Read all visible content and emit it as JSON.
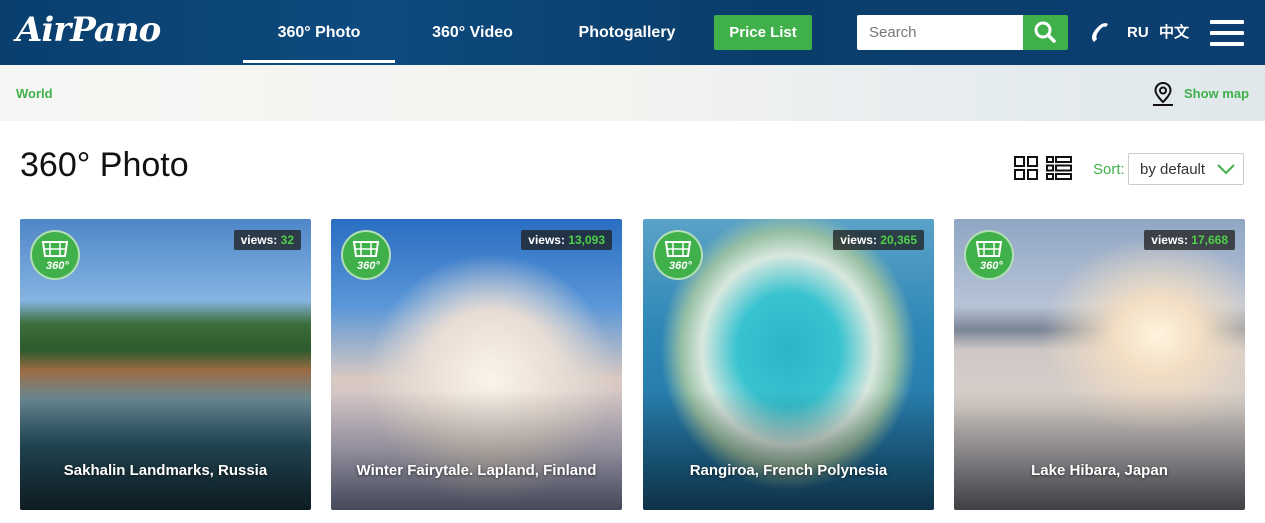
{
  "header": {
    "logo": "AirPano",
    "nav": [
      "360° Photo",
      "360° Video",
      "Photogallery"
    ],
    "price_label": "Price List",
    "search_placeholder": "Search",
    "lang_ru": "RU",
    "lang_cn": "中文"
  },
  "breadcrumb": {
    "world": "World",
    "show_map": "Show map"
  },
  "page": {
    "title": "360° Photo",
    "sort_label": "Sort:",
    "sort_value": "by default"
  },
  "cards": [
    {
      "title": "Sakhalin Landmarks, Russia",
      "views_label": "views:",
      "views": "32"
    },
    {
      "title": "Winter Fairytale. Lapland, Finland",
      "views_label": "views:",
      "views": "13,093"
    },
    {
      "title": "Rangiroa, French Polynesia",
      "views_label": "views:",
      "views": "20,365"
    },
    {
      "title": "Lake Hibara, Japan",
      "views_label": "views:",
      "views": "17,668"
    }
  ],
  "badge_text": "360°",
  "colors": {
    "brand_green": "#3fb04a",
    "header_blue": "#0b4273"
  },
  "icons": [
    "search-icon",
    "phone-icon",
    "menu-icon",
    "map-pin-icon",
    "grid-view-icon",
    "list-view-icon",
    "chevron-down-icon",
    "panorama-360-icon"
  ]
}
